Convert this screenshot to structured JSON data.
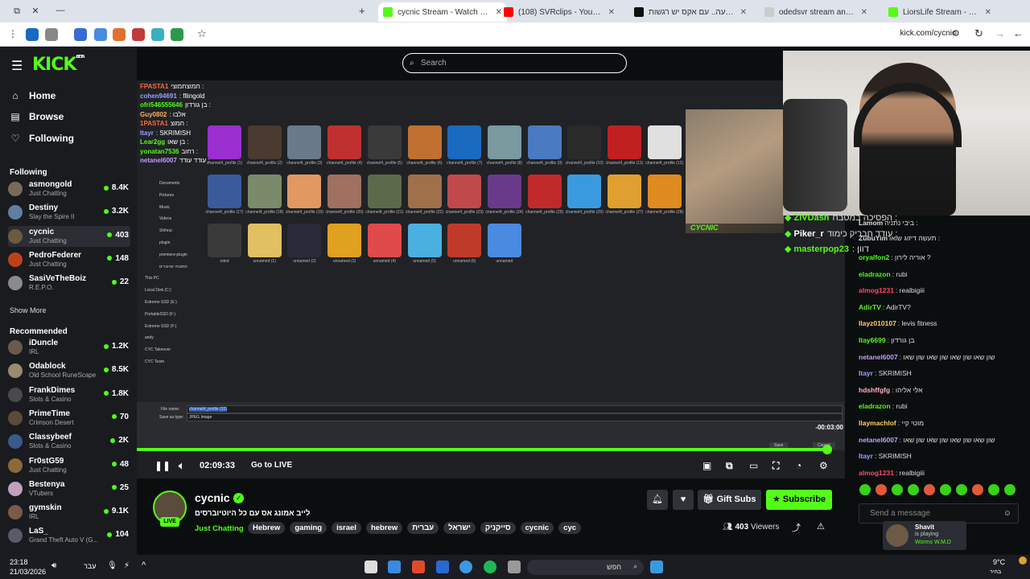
{
  "browser": {
    "tabs": [
      {
        "title": "cycnic Stream - Watch Live",
        "active": true,
        "icon": "kick-favicon",
        "color": "#53fc18"
      },
      {
        "title": "(108) SVRclips - YouTube",
        "active": false,
        "icon": "youtube-favicon",
        "color": "#ff0000"
      },
      {
        "title": "הקריין לא טועה.. עם אקס יש רגשות",
        "active": false,
        "icon": "tiktok-favicon",
        "color": "#111111"
      },
      {
        "title": "odedsvr stream analytics & sta",
        "active": false,
        "icon": "analytics-favicon",
        "color": "#cccccc"
      },
      {
        "title": "LiorsLife Stream - Watch Live o",
        "active": false,
        "icon": "kick-favicon",
        "color": "#53fc18"
      }
    ],
    "url": "kick.com/cycnic"
  },
  "sidebar": {
    "logo": "KICK",
    "logo_badge": "BETA",
    "nav": [
      {
        "label": "Home",
        "icon": "home-icon",
        "glyph": "⌂"
      },
      {
        "label": "Browse",
        "icon": "browse-icon",
        "glyph": "▤"
      },
      {
        "label": "Following",
        "icon": "heart-icon",
        "glyph": "♡"
      }
    ],
    "following_header": "Following",
    "following": [
      {
        "name": "asmongold",
        "category": "Just Chatting",
        "viewers": "8.4K",
        "color": "#7a6a5a"
      },
      {
        "name": "Destiny",
        "category": "Slay the Spire II",
        "viewers": "3.2K",
        "color": "#5f7fa0"
      },
      {
        "name": "cycnic",
        "category": "Just Chatting",
        "viewers": "403",
        "color": "#6a5a40"
      },
      {
        "name": "PedroFederer",
        "category": "Just Chatting",
        "viewers": "148",
        "color": "#c0401a"
      },
      {
        "name": "SasiVeTheBoiz",
        "category": "R.E.P.O.",
        "viewers": "22",
        "color": "#8a8a8a"
      }
    ],
    "show_more": "Show More",
    "recommended_header": "Recommended",
    "recommended": [
      {
        "name": "iDuncle",
        "category": "IRL",
        "viewers": "1.2K",
        "color": "#6b5a4a"
      },
      {
        "name": "Odablock",
        "category": "Old School RuneScape",
        "viewers": "8.5K",
        "color": "#9a8a70"
      },
      {
        "name": "FrankDimes",
        "category": "Slots & Casino",
        "viewers": "1.8K",
        "color": "#4a4a4a"
      },
      {
        "name": "PrimeTime",
        "category": "Crimson Desert",
        "viewers": "70",
        "color": "#5a4a3a"
      },
      {
        "name": "Classybeef",
        "category": "Slots & Casino",
        "viewers": "2K",
        "color": "#3a5a8a"
      },
      {
        "name": "Fr0stG59",
        "category": "Just Chatting",
        "viewers": "48",
        "color": "#8a6a3a"
      },
      {
        "name": "Bestenya",
        "category": "VTubers",
        "viewers": "25",
        "color": "#c0a0c0"
      },
      {
        "name": "gymskin",
        "category": "IRL",
        "viewers": "9.1K",
        "color": "#7a5a4a"
      },
      {
        "name": "LaS_",
        "category": "Grand Theft Auto V (G...",
        "viewers": "104",
        "color": "#5a5a6a"
      }
    ]
  },
  "search": {
    "placeholder": "Search"
  },
  "player": {
    "timestamp": "02:09:33",
    "go_live": "Go to LIVE",
    "time_remaining": "-00:03:00",
    "progress": 0.975,
    "overlay_chat": [
      {
        "user": "FPASTA1",
        "text": "חמוצחמוצי :",
        "color": "#ff6a3a"
      },
      {
        "user": "cohen94691",
        "text": ": fllingold",
        "color": "#9aa0ff"
      },
      {
        "user": "ofri546555646",
        "text": "בן גורדון :",
        "color": "#53fc18"
      },
      {
        "user": "Guy0802",
        "text": ": אלבו",
        "color": "#ffb060"
      },
      {
        "user": "1PASTA1",
        "text": "חמוצ :",
        "color": "#ff6a3a"
      },
      {
        "user": "Itayr",
        "text": ": SKRIMISH",
        "color": "#9aa0ff"
      },
      {
        "user": "Lear2gg",
        "text": "בן שאו :",
        "color": "#53fc18"
      },
      {
        "user": "yonatan7536",
        "text": "רחוב :",
        "color": "#53fc18"
      },
      {
        "user": "netanel6007",
        "text": "עודד עודד :",
        "color": "#c0a0ff"
      }
    ],
    "file_name_label": "File name:",
    "file_name_value": "channel4_profile (32)",
    "save_type_label": "Save as type:",
    "save_type_value": "JPEG Image",
    "save_btn": "Save",
    "cancel_btn": "Cancel",
    "tree": [
      "Documents",
      "Pictures",
      "Music",
      "Videos",
      "Shihrur",
      "plugin",
      "premiere-plugin",
      "תמונות יוטיוברים",
      "This PC",
      "Local Disk (C:)",
      "Extreme SSD (E:)",
      "PortableSSD (F:)",
      "Extreme SSD (F:)",
      "andy",
      "CYC Takeover",
      "CYC Team"
    ],
    "thumb_labels": [
      "channel4_profile (1)",
      "channel4_profile (2)",
      "channel4_profile (3)",
      "channel4_profile (4)",
      "channel4_profile (5)",
      "channel4_profile (6)",
      "channel4_profile (7)",
      "channel4_profile (8)",
      "channel4_profile (9)",
      "channel4_profile (10)",
      "channel4_profile (11)",
      "channel4_profile (12)",
      "channel4_profile (17)",
      "channel4_profile (18)",
      "channel4_profile (19)",
      "channel4_profile (20)",
      "channel4_profile (21)",
      "channel4_profile (22)",
      "channel4_profile (23)",
      "channel4_profile (24)",
      "channel4_profile (25)",
      "channel4_profile (26)",
      "channel4_profile (27)",
      "channel4_profile (28)",
      "oded",
      "unnamed (1)",
      "unnamed (2)",
      "unnamed (3)",
      "unnamed (4)",
      "unnamed (5)",
      "unnamed (6)",
      "unnamed"
    ],
    "thumb_colors": [
      "#9b2fd0",
      "#4a3a30",
      "#6a7a8a",
      "#c03030",
      "#3a3a3a",
      "#c07030",
      "#1a6ac0",
      "#7a9aa0",
      "#4a7ac0",
      "#2a2a2a",
      "#c02020",
      "#e0e0e0",
      "#3a5a9a",
      "#7a8a6a",
      "#e09a60",
      "#a07060",
      "#5a6a4a",
      "#a0704a",
      "#c04a4a",
      "#6a3a8a",
      "#c02a2a",
      "#3a9ae0",
      "#e0a030",
      "#e08a20",
      "#3a3a3a",
      "#e0c060",
      "#2a2a3a",
      "#e0a020",
      "#e04a4a",
      "#4ab0e0",
      "#c03a2a",
      "#4a8ae0"
    ],
    "cam_tag": "CYCNIC"
  },
  "chat": {
    "overlay_lines": [
      {
        "user": "ZiVDash",
        "text": "הפסיכה במטבח :",
        "color": "#53fc18"
      },
      {
        "user": "Piker_r",
        "text": "עודד חבריק כימוד :",
        "color": "#ffffff"
      },
      {
        "user": "masterpop23",
        "text": ": דוון",
        "color": "#53fc18"
      }
    ],
    "messages": [
      {
        "user": "Lamom",
        "text": "ביבי נתניה :",
        "color": "#ddd"
      },
      {
        "user": "ZubuYim",
        "text": "תעשה דיזוג שואו :",
        "color": "#ddd"
      },
      {
        "user": "oryalfon2",
        "text": ": אוריה לירון ?",
        "color": "#53fc18"
      },
      {
        "user": "eladrazon",
        "text": ": rubi",
        "color": "#53fc18"
      },
      {
        "user": "almog1231",
        "text": ": realbigiii",
        "color": "#ff4a6a"
      },
      {
        "user": "AdirTV",
        "text": ": AdirTV?",
        "color": "#53fc18"
      },
      {
        "user": "Ilayz010107",
        "text": ": levis fitness",
        "color": "#ffd060"
      },
      {
        "user": "Itay6699",
        "text": ": בן גורדון",
        "color": "#53fc18"
      },
      {
        "user": "netanel6007",
        "text": ": שון שאו שון שאו שון שאו שון שאו",
        "color": "#c0a0ff"
      },
      {
        "user": "Itayr",
        "text": ": SKRIMISH",
        "color": "#9aa0ff"
      },
      {
        "user": "hdshffgfg",
        "text": ": אלי אליהו",
        "color": "#ffb0c0"
      },
      {
        "user": "eladrazon",
        "text": ": rubi",
        "color": "#53fc18"
      },
      {
        "user": "llaymachlof",
        "text": ": מוטי קיי",
        "color": "#ffd060"
      },
      {
        "user": "netanel6007",
        "text": ": שון שאו שון שאו שון שאו שון שאו",
        "color": "#c0a0ff"
      },
      {
        "user": "Itayr",
        "text": ": SKRIMISH",
        "color": "#9aa0ff"
      },
      {
        "user": "almog1231",
        "text": ": realbigiii",
        "color": "#ff4a6a"
      }
    ],
    "input_placeholder": "Send a message"
  },
  "stream": {
    "streamer": "cycnic",
    "live": "LIVE",
    "title": "לייב אמונג אס עם כל היוטיוברסים",
    "category": "Just Chatting",
    "tags": [
      "Hebrew",
      "gaming",
      "israel",
      "hebrew",
      "עברית",
      "ישראל",
      "סייקניק",
      "cycnic",
      "cyc"
    ],
    "gift_subs": "Gift Subs",
    "subscribe": "Subscribe",
    "viewers": "403",
    "viewers_label": "Viewers"
  },
  "toast": {
    "name": "Shavit",
    "status": "is playing",
    "game": "Worms W.M.D"
  },
  "taskbar": {
    "time": "23:18",
    "date": "21/03/2026",
    "lang": "עבר",
    "search_placeholder": "חפש",
    "temp": "9°C",
    "weather": "בהיר"
  }
}
